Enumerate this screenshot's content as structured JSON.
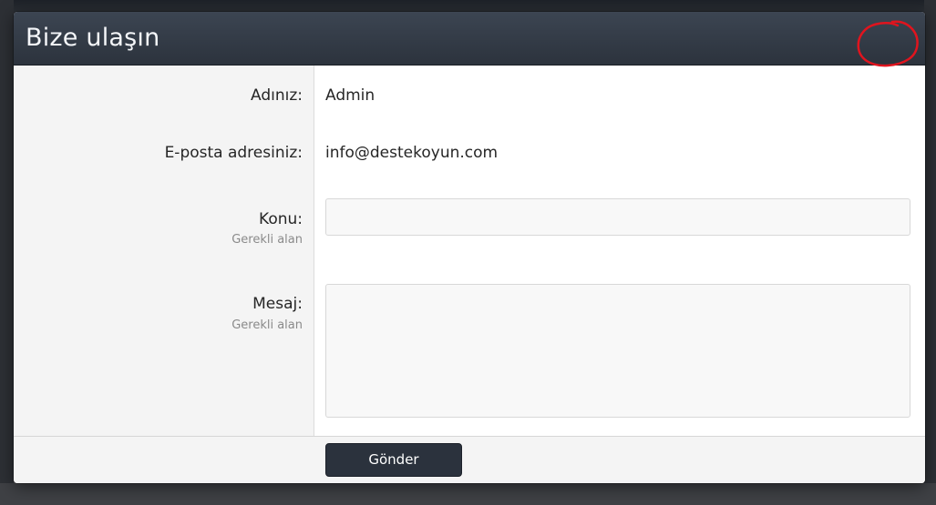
{
  "dialog": {
    "title": "Bize ulaşın"
  },
  "form": {
    "name_label": "Adınız:",
    "name_value": "Admin",
    "email_label": "E-posta adresiniz:",
    "email_value": "info@destekoyun.com",
    "subject_label": "Konu:",
    "subject_hint": "Gerekli alan",
    "subject_value": "",
    "message_label": "Mesaj:",
    "message_hint": "Gerekli alan",
    "message_value": ""
  },
  "footer": {
    "submit_label": "Gönder"
  },
  "colors": {
    "header_bg": "#2f3742",
    "button_bg": "#2b323d",
    "annotation": "#e0141e"
  },
  "icons": {
    "annotation": "red-circle-annotation-icon"
  }
}
